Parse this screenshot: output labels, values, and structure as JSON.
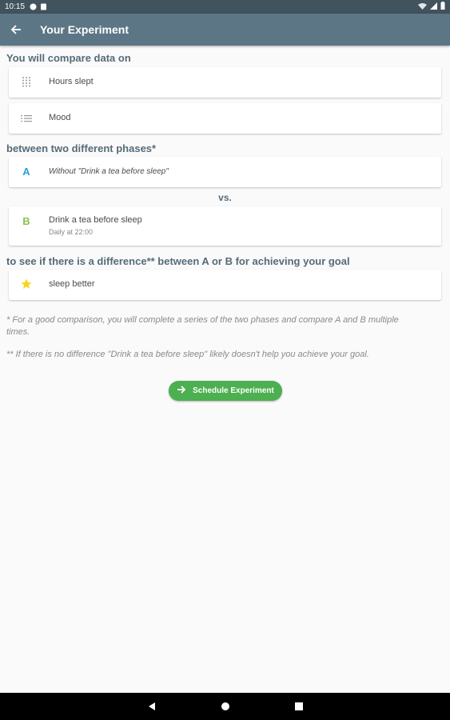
{
  "status_bar": {
    "time": "10:15"
  },
  "app_bar": {
    "title": "Your Experiment"
  },
  "compare": {
    "heading": "You will compare data on",
    "items": [
      {
        "label": "Hours slept",
        "icon": "grid-icon"
      },
      {
        "label": "Mood",
        "icon": "list-icon"
      }
    ]
  },
  "phases": {
    "heading": "between two different phases*",
    "a": {
      "letter": "A",
      "label": "Without \"Drink a tea before sleep\""
    },
    "vs": "vs.",
    "b": {
      "letter": "B",
      "label": "Drink a tea before sleep",
      "schedule": "Daily at 22:00"
    }
  },
  "goal": {
    "heading": "to see if there is a difference** between A or B for achieving your goal",
    "label": "sleep better"
  },
  "notes": {
    "note1": "* For a good comparison, you will complete a series of the two phases and compare A and B multiple times.",
    "note2": "** If there is no difference \"Drink a tea before sleep\" likely doesn't help you achieve your goal."
  },
  "cta": {
    "label": "Schedule Experiment"
  },
  "colors": {
    "app_bar": "#5d7685",
    "phase_a": "#2a9fd6",
    "phase_b": "#8bc34a",
    "cta": "#4caf50",
    "star": "#f7d51d"
  }
}
